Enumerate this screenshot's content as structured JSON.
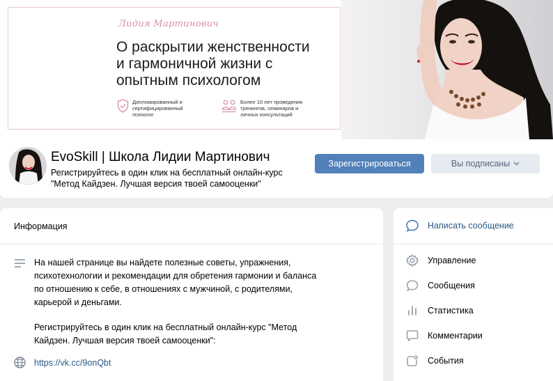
{
  "cover": {
    "name": "Лидия Мартинович",
    "headline": [
      "О раскрытии женственности",
      "и гармоничной жизни с",
      "опытным психологом"
    ],
    "feature1": [
      "Дипломированный и",
      "сертифицированный",
      "психолог"
    ],
    "feature2": [
      "Более 10 лет проведения",
      "тренингов, семинаров и",
      "личных консультаций"
    ]
  },
  "header": {
    "title": "EvoSkill | Школа Лидии Мартинович",
    "status": [
      "Регистрируйтесь в один клик на бесплатный онлайн-курс",
      "\"Метод Кайдзен. Лучшая версия твоей самооценки\""
    ],
    "register_button": "Зарегистрироваться",
    "subscribed_button": "Вы подписаны"
  },
  "info": {
    "title": "Информация",
    "description_p1": [
      "На нашей странице вы найдете полезные советы, упражнения,",
      "психотехнологии и рекомендации для обретения гармонии и баланса",
      "по отношению к себе, в отношениях с мужчиной, с родителями,",
      "карьерой и деньгами."
    ],
    "description_p2": [
      "Регистрируйтесь в один клик на бесплатный онлайн-курс \"Метод",
      "Кайдзен. Лучшая версия твоей самооценки\":"
    ],
    "link": "https://vk.cc/9onQbt"
  },
  "side_menu": {
    "write_message": "Написать сообщение",
    "items": [
      {
        "label": "Управление",
        "icon": "gear-icon"
      },
      {
        "label": "Сообщения",
        "icon": "message-icon"
      },
      {
        "label": "Статистика",
        "icon": "stats-icon"
      },
      {
        "label": "Комментарии",
        "icon": "comment-icon"
      },
      {
        "label": "События",
        "icon": "events-icon"
      }
    ]
  },
  "colors": {
    "accent": "#5181b8",
    "link": "#2a5885",
    "secondary_button_bg": "#e5ebf1",
    "page_bg": "#edeef0",
    "cover_pink": "#d98ea4"
  }
}
